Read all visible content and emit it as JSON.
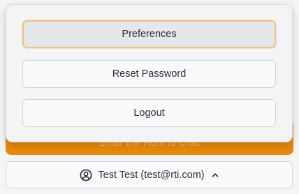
{
  "menu": {
    "items": [
      {
        "label": "Preferences",
        "active": true
      },
      {
        "label": "Reset Password",
        "active": false
      },
      {
        "label": "Logout",
        "active": false
      }
    ]
  },
  "primary_action": {
    "label": "Enter the Hunt to Chat"
  },
  "user": {
    "display": "Test Test (test@rti.com)",
    "avatar_icon": "user-circle-icon",
    "toggle_icon": "chevron-up-icon"
  },
  "colors": {
    "accent": "#e8890c",
    "focus_ring": "#efc28a"
  }
}
